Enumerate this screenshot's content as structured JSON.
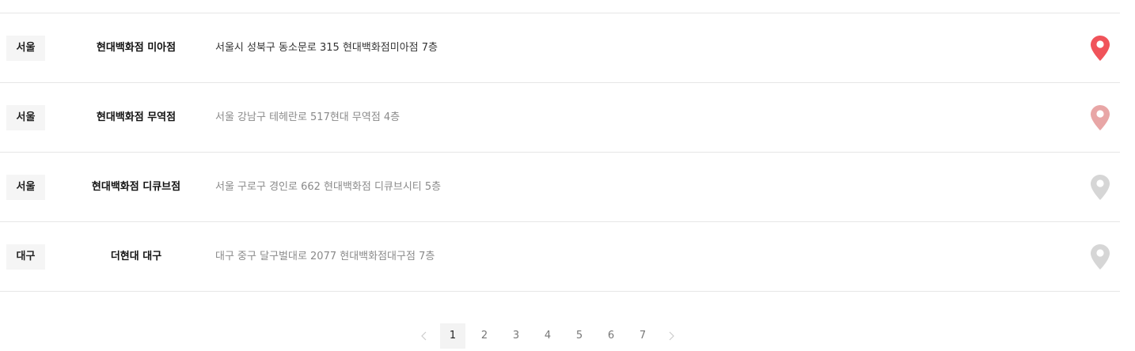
{
  "stores": [
    {
      "region": "서울",
      "name": "현대백화점 미아점",
      "address": "서울시 성북구 동소문로 315 현대백화점미아점 7층",
      "pin_color": "#f0535a",
      "address_color": "dark"
    },
    {
      "region": "서울",
      "name": "현대백화점 무역점",
      "address": "서울 강남구 테헤란로 517현대 무역점 4층",
      "pin_color": "#e8a6a6",
      "address_color": "light"
    },
    {
      "region": "서울",
      "name": "현대백화점 디큐브점",
      "address": "서울 구로구 경인로 662 현대백화점 디큐브시티 5층",
      "pin_color": "#d6d6d6",
      "address_color": "light"
    },
    {
      "region": "대구",
      "name": "더현대 대구",
      "address": "대구 중구 달구벌대로 2077 현대백화점대구점 7층",
      "pin_color": "#d6d6d6",
      "address_color": "light"
    }
  ],
  "pagination": {
    "prev_icon": "chevron-left-icon",
    "next_icon": "chevron-right-icon",
    "pages": [
      "1",
      "2",
      "3",
      "4",
      "5",
      "6",
      "7"
    ],
    "current": "1"
  },
  "icons": {
    "location": "map-pin-icon"
  }
}
